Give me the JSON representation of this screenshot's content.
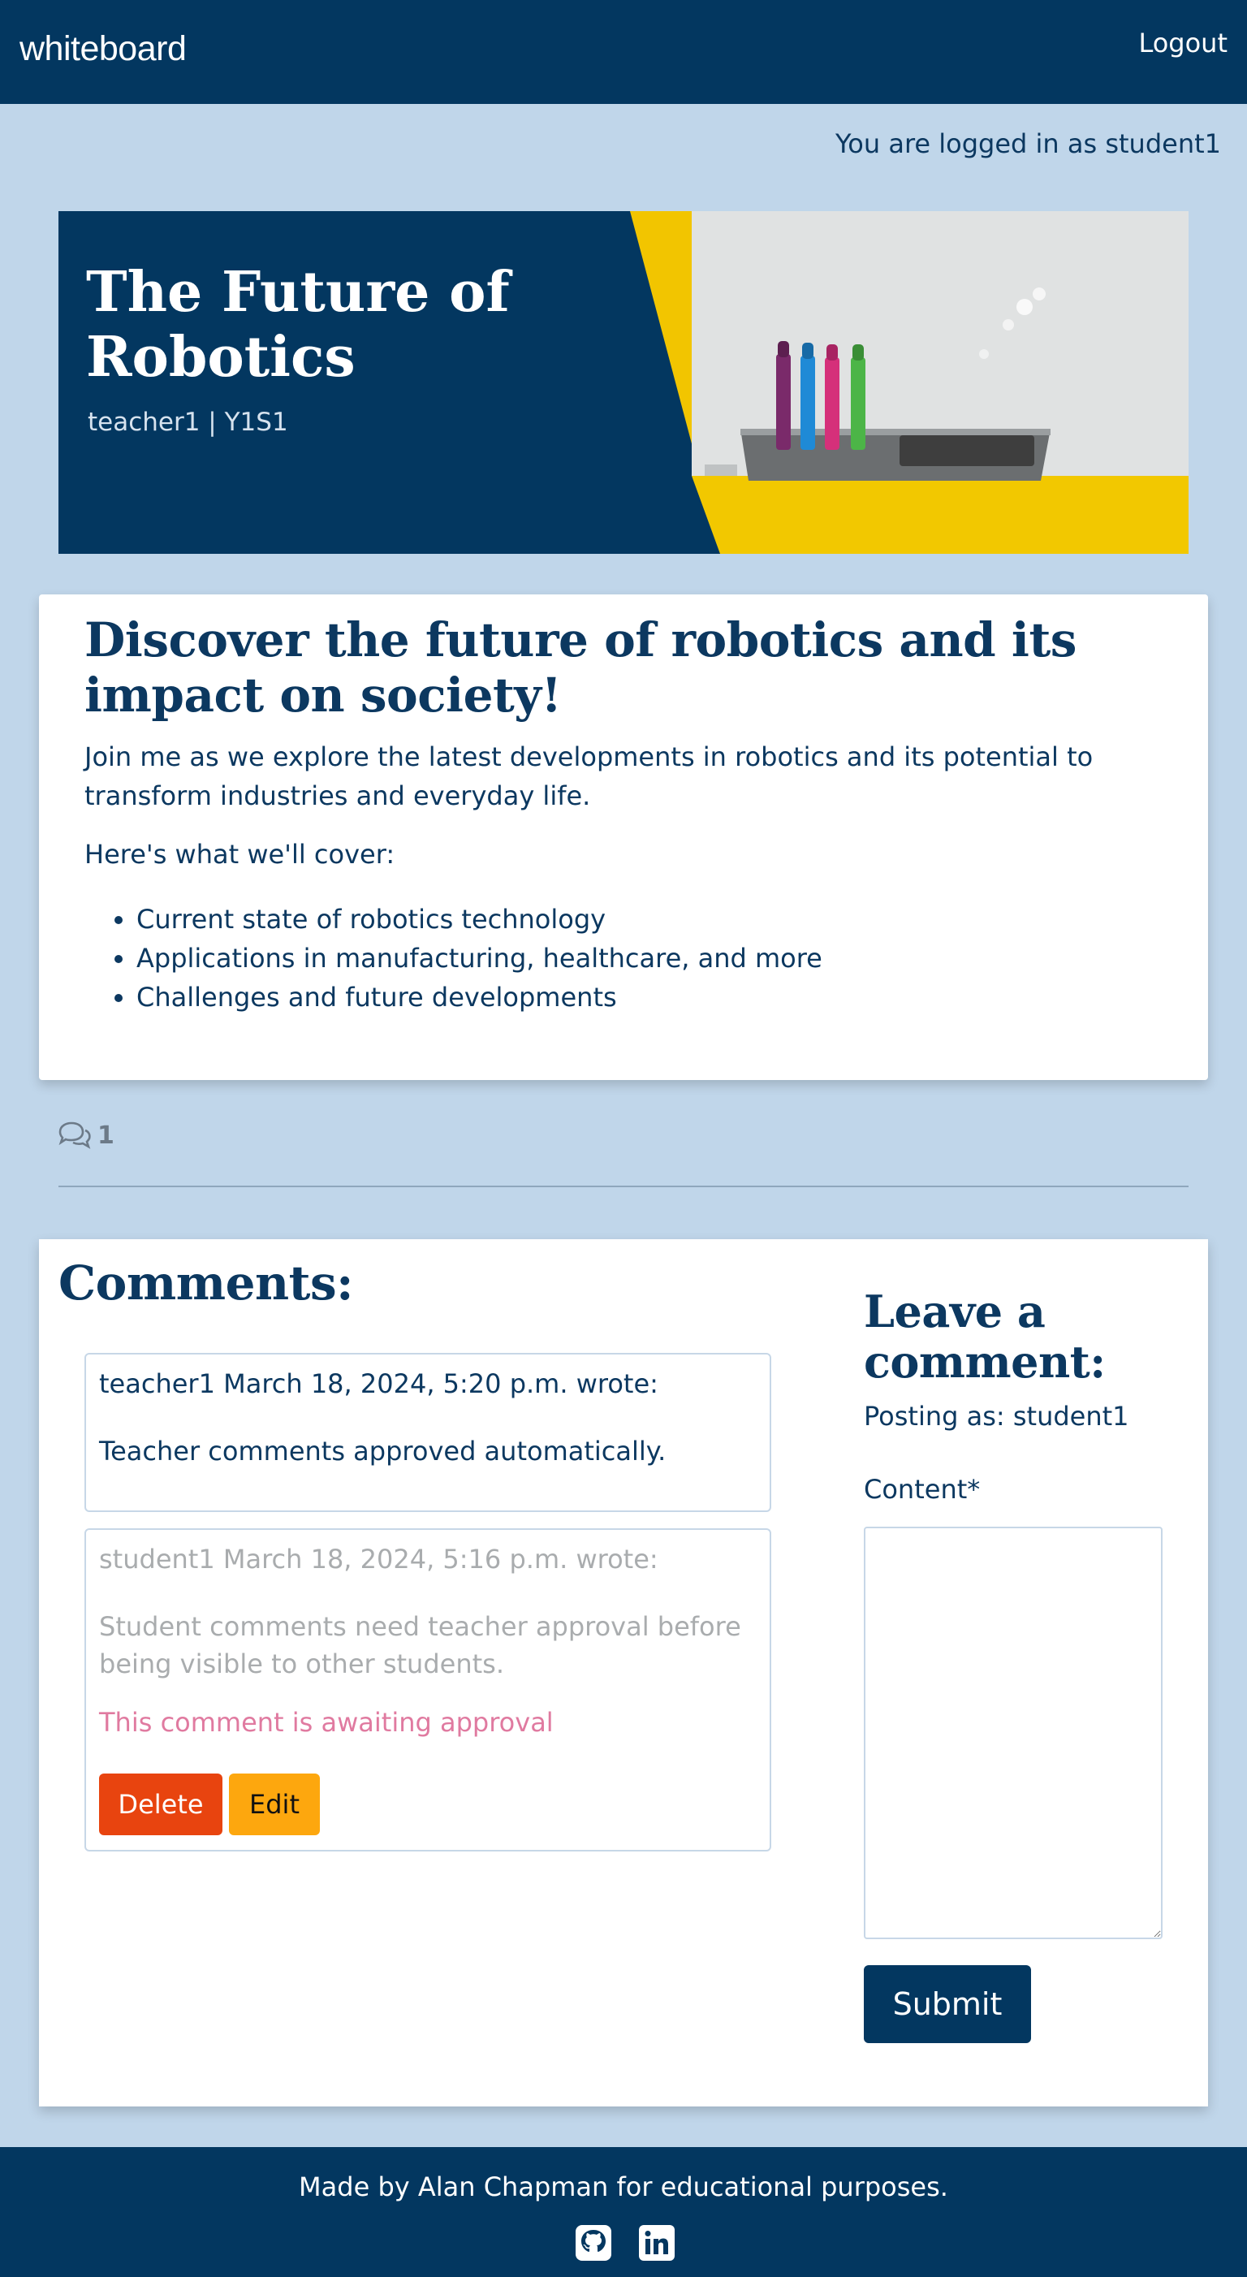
{
  "nav": {
    "brand": "whiteboard",
    "logout_label": "Logout"
  },
  "session": {
    "logged_in_text": "You are logged in as student1"
  },
  "hero": {
    "title": "The Future of Robotics",
    "meta": "teacher1 | Y1S1",
    "image_icon": "whiteboard-markers-photo"
  },
  "post": {
    "heading": "Discover the future of robotics and its impact on society!",
    "intro": "Join me as we explore the latest developments in robotics and its potential to transform industries and everyday life.",
    "cover_label": "Here's what we'll cover:",
    "items": [
      "Current state of robotics technology",
      "Applications in manufacturing, healthcare, and more",
      "Challenges and future developments"
    ]
  },
  "comment_count": {
    "icon": "comments-icon",
    "value": "1"
  },
  "comments": {
    "heading": "Comments:",
    "items": [
      {
        "header": "teacher1 March 18, 2024, 5:20 p.m. wrote:",
        "body": "Teacher comments approved automatically."
      },
      {
        "header": "student1 March 18, 2024, 5:16 p.m. wrote:",
        "body": "Student comments need teacher approval before being visible to other students.",
        "status": "This comment is awaiting approval",
        "delete_label": "Delete",
        "edit_label": "Edit"
      }
    ]
  },
  "comment_form": {
    "heading": "Leave a comment:",
    "posting_as": "Posting as: student1",
    "content_label": "Content*",
    "content_value": "",
    "submit_label": "Submit"
  },
  "footer": {
    "text": "Made by Alan Chapman for educational purposes.",
    "icons": [
      "github-icon",
      "linkedin-icon"
    ]
  },
  "colors": {
    "primary": "#033760",
    "background": "#c0d6ea",
    "accent_yellow": "#f2c500",
    "delete": "#e8440f",
    "edit": "#fda70e",
    "awaiting": "#e07aa0"
  }
}
